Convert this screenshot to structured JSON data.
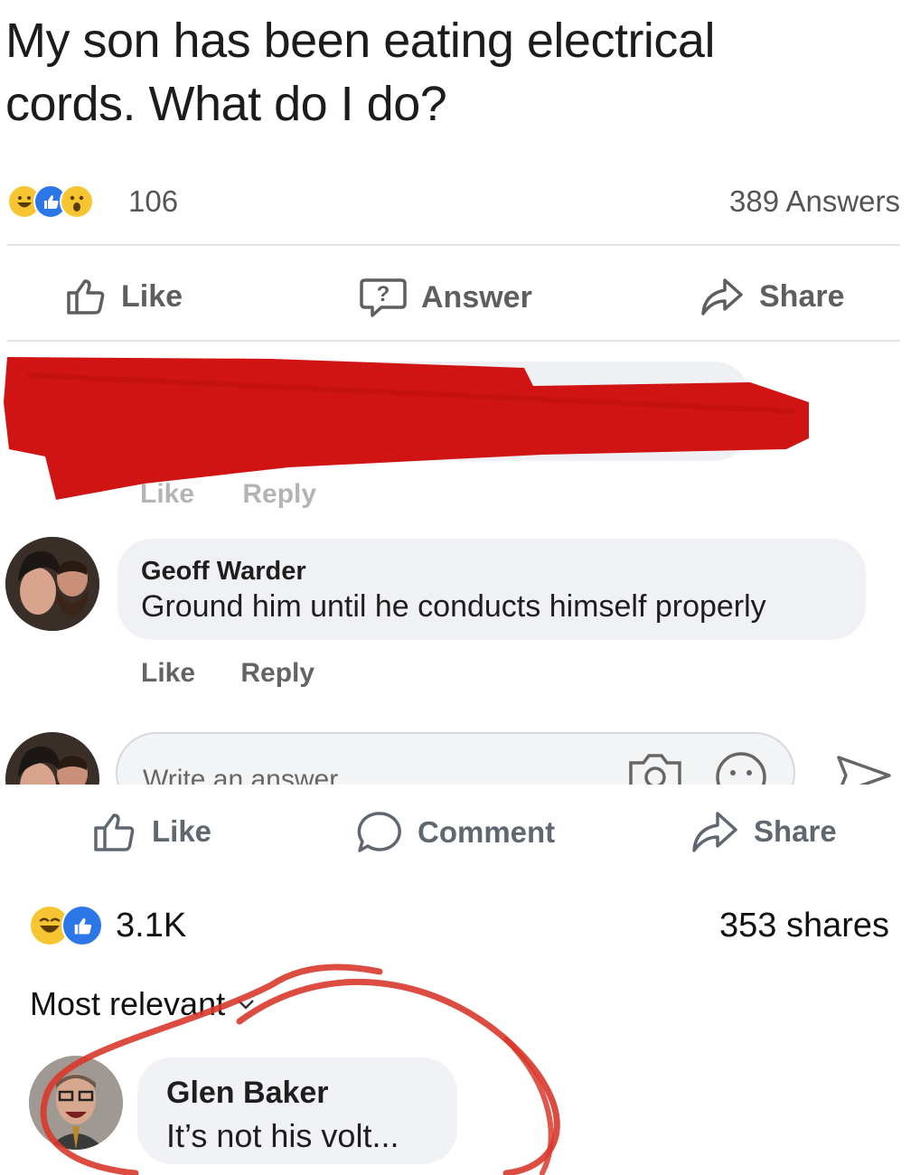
{
  "question": {
    "title_line1": "My son has been eating electrical",
    "title_line2": "cords. What do I do?",
    "reaction_icons": [
      "laughing-emoji-icon",
      "like-icon",
      "wow-emoji-icon"
    ],
    "reaction_count": "106",
    "answers_count": "389 Answers"
  },
  "question_actions": {
    "like_label": "Like",
    "answer_label": "Answer",
    "share_label": "Share"
  },
  "redacted_comment": {
    "like_label": "Like",
    "reply_label": "Reply"
  },
  "comment": {
    "author": "Geoff Warder",
    "text": "Ground him until he conducts himself properly",
    "like_label": "Like",
    "reply_label": "Reply"
  },
  "composer": {
    "placeholder": "Write an answer"
  },
  "post_actions": {
    "like_label": "Like",
    "comment_label": "Comment",
    "share_label": "Share"
  },
  "post_stats": {
    "reaction_icons": [
      "laughing-emoji-icon",
      "like-icon"
    ],
    "reaction_count": "3.1K",
    "shares_count": "353 shares"
  },
  "sort": {
    "label": "Most relevant"
  },
  "top_comment": {
    "author": "Glen Baker",
    "text": "It’s not his volt..."
  },
  "colors": {
    "facebook_blue": "#2c77e8",
    "emoji_yellow": "#f7c531",
    "redaction_red": "#d01414",
    "circle_annotation": "#d8392b"
  }
}
